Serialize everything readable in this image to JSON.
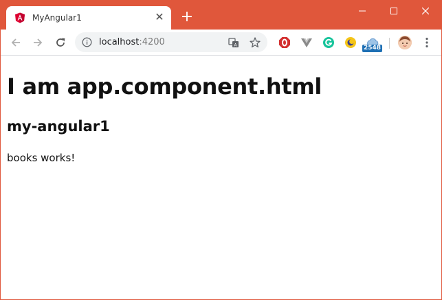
{
  "browser": {
    "tab": {
      "title": "MyAngular1",
      "favicon": "angular-icon",
      "close": "✕"
    },
    "new_tab": "+",
    "window_controls": [
      "minimize-icon",
      "maximize-icon",
      "close-icon"
    ],
    "accent_color": "#e0573b",
    "address": {
      "host": "localhost",
      "port": ":4200"
    },
    "extensions": {
      "badge_count": "2548"
    }
  },
  "page": {
    "heading": "I am app.component.html",
    "subheading": "my-angular1",
    "text": "books works!"
  }
}
